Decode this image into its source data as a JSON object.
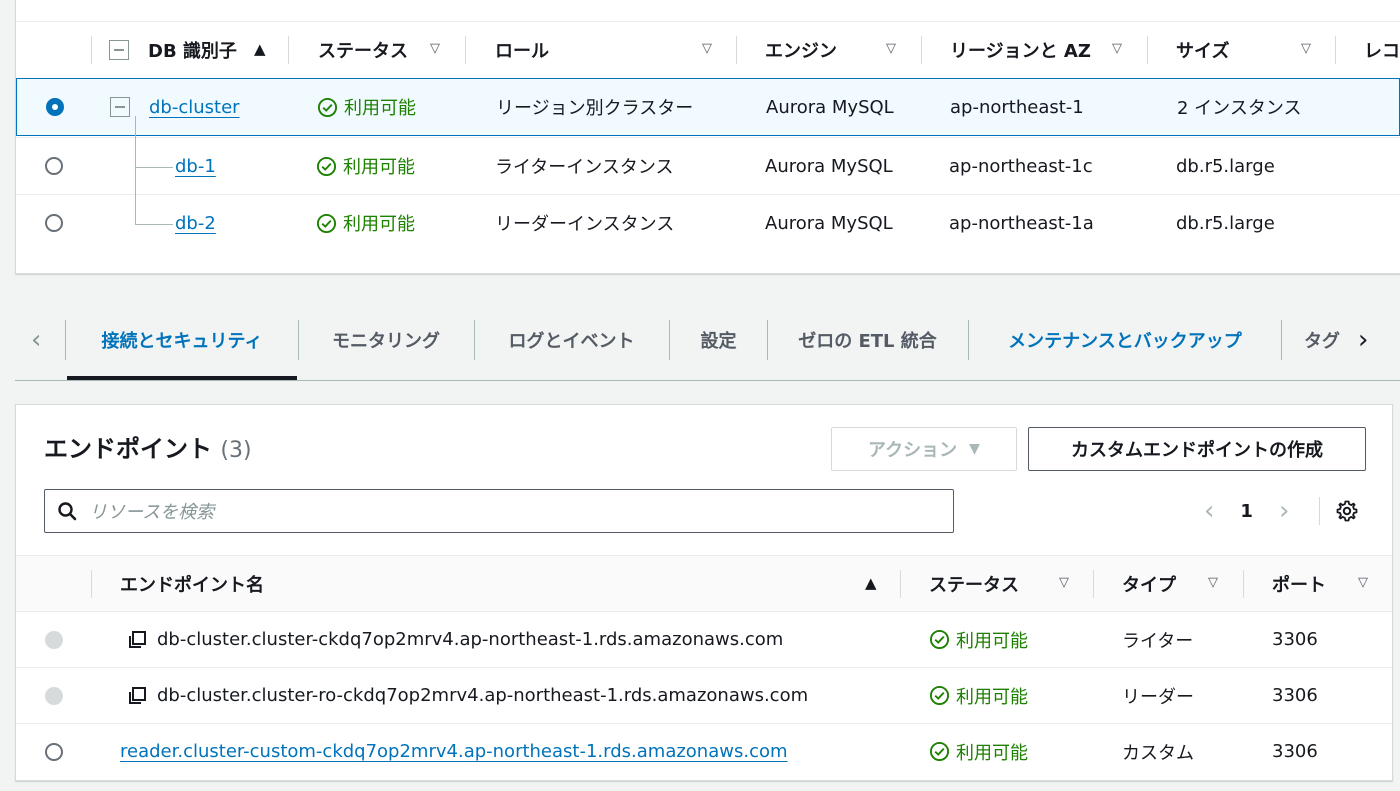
{
  "db_table": {
    "columns": {
      "db_id": "DB 識別子",
      "status": "ステータス",
      "role": "ロール",
      "engine": "エンジン",
      "region": "リージョンと AZ",
      "size": "サイズ",
      "next": "レコ"
    },
    "rows": [
      {
        "id": "db-cluster",
        "status": "利用可能",
        "role": "リージョン別クラスター",
        "engine": "Aurora MySQL",
        "region": "ap-northeast-1",
        "size": "2 インスタンス",
        "selected": true
      },
      {
        "id": "db-1",
        "status": "利用可能",
        "role": "ライターインスタンス",
        "engine": "Aurora MySQL",
        "region": "ap-northeast-1c",
        "size": "db.r5.large",
        "selected": false
      },
      {
        "id": "db-2",
        "status": "利用可能",
        "role": "リーダーインスタンス",
        "engine": "Aurora MySQL",
        "region": "ap-northeast-1a",
        "size": "db.r5.large",
        "selected": false
      }
    ]
  },
  "tabs": [
    {
      "label": "接続とセキュリティ",
      "active": true
    },
    {
      "label": "モニタリング"
    },
    {
      "label": "ログとイベント"
    },
    {
      "label": "設定"
    },
    {
      "label": "ゼロの ETL 統合"
    },
    {
      "label": "メンテナンスとバックアップ"
    },
    {
      "label": "タグ"
    }
  ],
  "endpoints": {
    "title": "エンドポイント",
    "count": "(3)",
    "actions_label": "アクション",
    "create_label": "カスタムエンドポイントの作成",
    "search_placeholder": "リソースを検索",
    "page": "1",
    "columns": {
      "name": "エンドポイント名",
      "status": "ステータス",
      "type": "タイプ",
      "port": "ポート"
    },
    "rows": [
      {
        "name": "db-cluster.cluster-ckdq7op2mrv4.ap-northeast-1.rds.amazonaws.com",
        "status": "利用可能",
        "type": "ライター",
        "port": "3306"
      },
      {
        "name": "db-cluster.cluster-ro-ckdq7op2mrv4.ap-northeast-1.rds.amazonaws.com",
        "status": "利用可能",
        "type": "リーダー",
        "port": "3306"
      },
      {
        "name": "reader.cluster-custom-ckdq7op2mrv4.ap-northeast-1.rds.amazonaws.com",
        "status": "利用可能",
        "type": "カスタム",
        "port": "3306"
      }
    ]
  },
  "colors": {
    "accent": "#0073bb",
    "success": "#1d8102",
    "border": "#d5dbdb"
  }
}
